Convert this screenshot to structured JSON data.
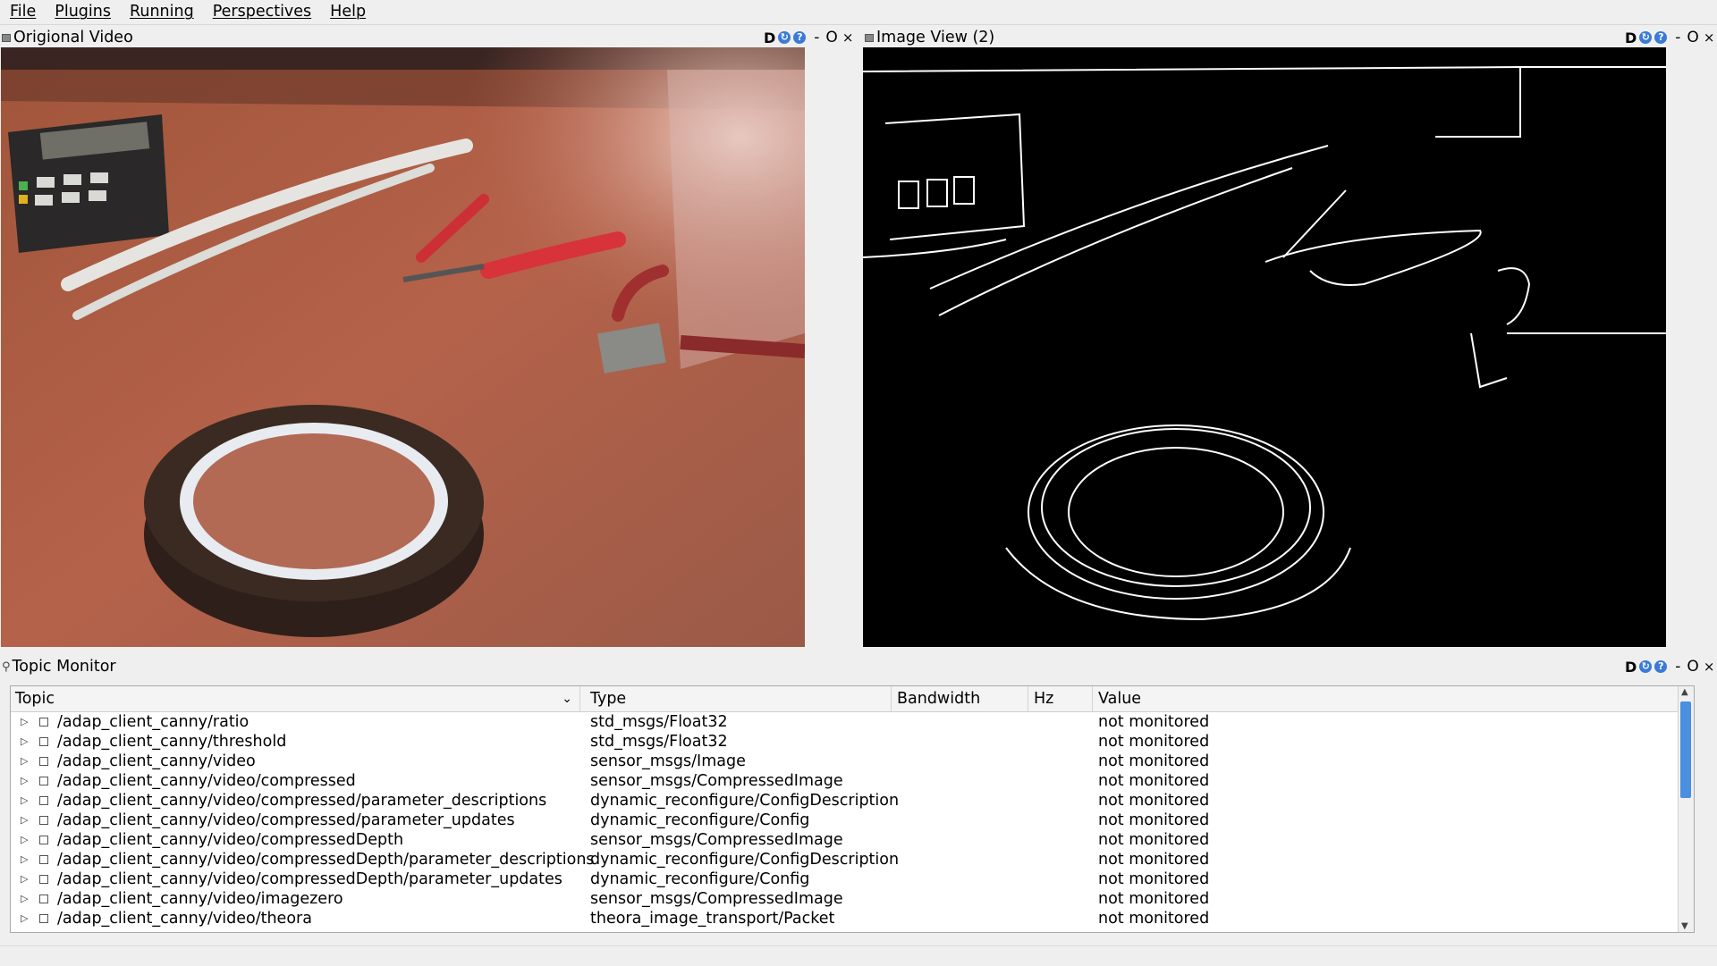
{
  "menu": [
    "File",
    "Plugins",
    "Running",
    "Perspectives",
    "Help"
  ],
  "docks": {
    "original_video": {
      "title": "Origional Video"
    },
    "image_view": {
      "title": "Image View (2)"
    },
    "topic_monitor": {
      "title": "Topic Monitor"
    }
  },
  "dock_controls": {
    "d": "D",
    "minus": "-",
    "o": "O",
    "close": "×"
  },
  "table": {
    "columns": [
      "Topic",
      "Type",
      "Bandwidth",
      "Hz",
      "Value"
    ],
    "rows": [
      {
        "topic": "/adap_client_canny/ratio",
        "type": "std_msgs/Float32",
        "bandwidth": "",
        "hz": "",
        "value": "not monitored"
      },
      {
        "topic": "/adap_client_canny/threshold",
        "type": "std_msgs/Float32",
        "bandwidth": "",
        "hz": "",
        "value": "not monitored"
      },
      {
        "topic": "/adap_client_canny/video",
        "type": "sensor_msgs/Image",
        "bandwidth": "",
        "hz": "",
        "value": "not monitored"
      },
      {
        "topic": "/adap_client_canny/video/compressed",
        "type": "sensor_msgs/CompressedImage",
        "bandwidth": "",
        "hz": "",
        "value": "not monitored"
      },
      {
        "topic": "/adap_client_canny/video/compressed/parameter_descriptions",
        "type": "dynamic_reconfigure/ConfigDescription",
        "bandwidth": "",
        "hz": "",
        "value": "not monitored"
      },
      {
        "topic": "/adap_client_canny/video/compressed/parameter_updates",
        "type": "dynamic_reconfigure/Config",
        "bandwidth": "",
        "hz": "",
        "value": "not monitored"
      },
      {
        "topic": "/adap_client_canny/video/compressedDepth",
        "type": "sensor_msgs/CompressedImage",
        "bandwidth": "",
        "hz": "",
        "value": "not monitored"
      },
      {
        "topic": "/adap_client_canny/video/compressedDepth/parameter_descriptions",
        "type": "dynamic_reconfigure/ConfigDescription",
        "bandwidth": "",
        "hz": "",
        "value": "not monitored"
      },
      {
        "topic": "/adap_client_canny/video/compressedDepth/parameter_updates",
        "type": "dynamic_reconfigure/Config",
        "bandwidth": "",
        "hz": "",
        "value": "not monitored"
      },
      {
        "topic": "/adap_client_canny/video/imagezero",
        "type": "sensor_msgs/CompressedImage",
        "bandwidth": "",
        "hz": "",
        "value": "not monitored"
      },
      {
        "topic": "/adap_client_canny/video/theora",
        "type": "theora_image_transport/Packet",
        "bandwidth": "",
        "hz": "",
        "value": "not monitored"
      }
    ]
  },
  "icons": {
    "dock_icon": "window-icon",
    "topic_icon": "search-icon",
    "refresh": "refresh-icon",
    "help": "help-icon"
  },
  "colors": {
    "accent": "#3b7ad6",
    "scroll_thumb": "#4a8fe0",
    "background": "#efefef"
  }
}
